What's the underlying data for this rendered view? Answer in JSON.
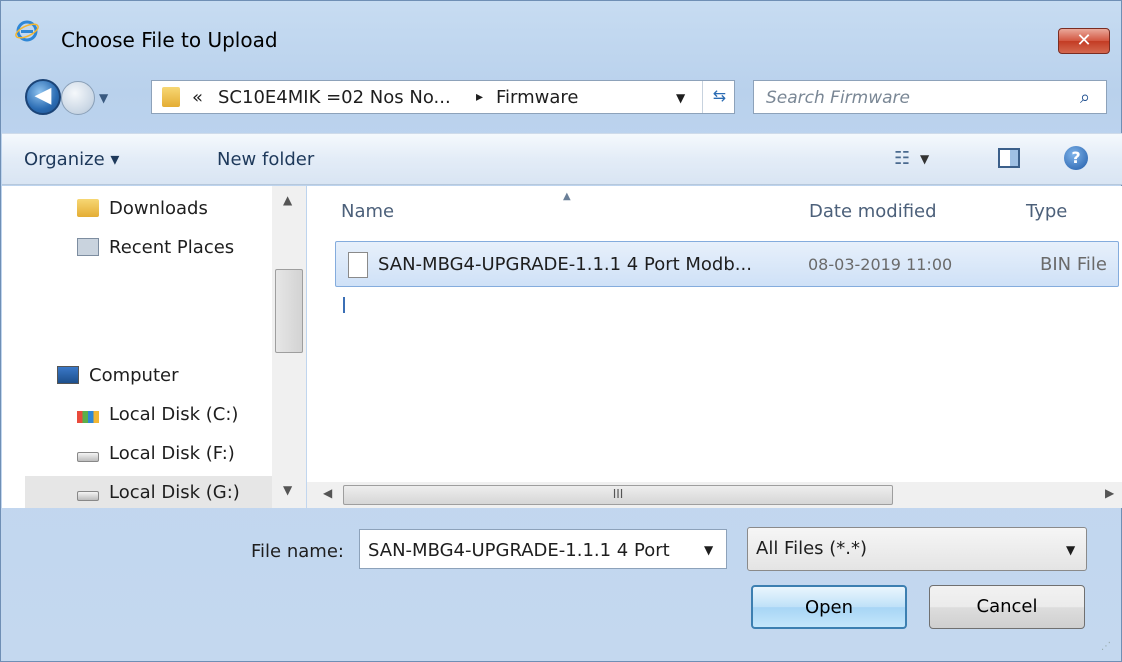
{
  "window": {
    "title": "Choose File to Upload",
    "close_label": "✕"
  },
  "address": {
    "overflow": "«",
    "path": "SC10E4MIK =02 Nos No...",
    "separator": "▸",
    "current": "Firmware"
  },
  "search": {
    "placeholder": "Search Firmware"
  },
  "toolbar": {
    "organize_label": "Organize ▾",
    "new_folder_label": "New folder"
  },
  "nav": {
    "items": [
      {
        "label": "Downloads"
      },
      {
        "label": "Recent Places"
      },
      {
        "label": "Computer"
      },
      {
        "label": "Local Disk (C:)"
      },
      {
        "label": "Local Disk (F:)"
      },
      {
        "label": "Local Disk (G:)"
      }
    ]
  },
  "columns": {
    "name": "Name",
    "date_modified": "Date modified",
    "type": "Type"
  },
  "files": [
    {
      "name": "SAN-MBG4-UPGRADE-1.1.1 4 Port Modb...",
      "date": "08-03-2019 11:00",
      "type": "BIN File"
    }
  ],
  "hscroll": {
    "grip": "III"
  },
  "bottom": {
    "file_name_label": "File name:",
    "file_name_value": "SAN-MBG4-UPGRADE-1.1.1 4 Port",
    "filter_value": "All Files (*.*)",
    "open_label": "Open",
    "cancel_label": "Cancel"
  },
  "colors": {
    "accent": "#3c7fb1",
    "selection": "#cfe1f7",
    "close": "#c33c24"
  }
}
